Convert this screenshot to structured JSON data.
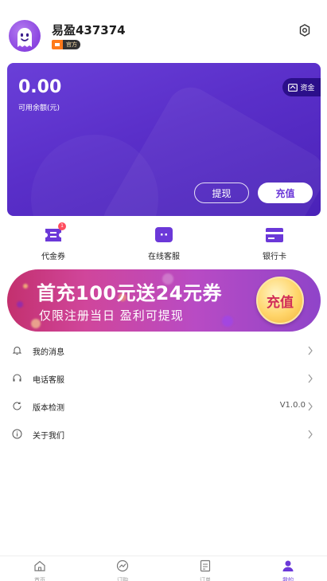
{
  "profile": {
    "username": "易盈437374",
    "badge_label": "官方"
  },
  "wallet": {
    "balance": "0.00",
    "balance_label": "可用余额(元)",
    "funds_label": "资金",
    "withdraw_label": "提现",
    "recharge_label": "充值"
  },
  "quick_actions": [
    {
      "label": "代金券",
      "icon": "voucher-icon",
      "badge": "1"
    },
    {
      "label": "在线客服",
      "icon": "chat-icon"
    },
    {
      "label": "银行卡",
      "icon": "bank-card-icon"
    }
  ],
  "banner": {
    "title": "首充100元送24元券",
    "subtitle": "仅限注册当日 盈利可提现",
    "button_label": "充值"
  },
  "menu": [
    {
      "label": "我的消息",
      "icon": "bell-icon",
      "value": ""
    },
    {
      "label": "电话客服",
      "icon": "headset-icon",
      "value": ""
    },
    {
      "label": "版本检测",
      "icon": "refresh-icon",
      "value": "V1.0.0"
    },
    {
      "label": "关于我们",
      "icon": "info-icon",
      "value": ""
    }
  ],
  "tabs": [
    {
      "label": "首页",
      "icon": "home-icon",
      "active": false
    },
    {
      "label": "订购",
      "icon": "chart-icon",
      "active": false
    },
    {
      "label": "订单",
      "icon": "document-icon",
      "active": false
    },
    {
      "label": "我的",
      "icon": "user-icon",
      "active": true
    }
  ],
  "colors": {
    "accent": "#6b38d8",
    "banner_pink": "#c3306e",
    "badge_red": "#ff4d5e"
  }
}
